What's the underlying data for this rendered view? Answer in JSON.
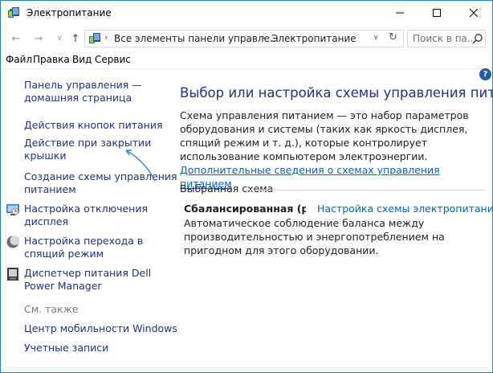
{
  "window": {
    "title": "Электропитание"
  },
  "address_bar": {
    "crumbs": [
      "Все элементы панели управле...",
      "Электропитание"
    ]
  },
  "search": {
    "placeholder": "Поиск в па..."
  },
  "menu": {
    "items": [
      "Файл",
      "Правка",
      "Вид",
      "Сервис"
    ]
  },
  "sidebar": {
    "home_link_line1": "Панель управления —",
    "home_link_line2": "домашняя страница",
    "power_buttons": "Действия кнопок питания",
    "lid_close_line1": "Действие при закрытии",
    "lid_close_line2": "крышки",
    "create_plan_line1": "Создание схемы управления",
    "create_plan_line2": "питанием",
    "display_off_line1": "Настройка отключения",
    "display_off_line2": "дисплея",
    "sleep_line1": "Настройка перехода в",
    "sleep_line2": "спящий режим",
    "dell_line1": "Диспетчер питания Dell",
    "dell_line2": "Power Manager",
    "see_also": "См. также",
    "mobility_center": "Центр мобильности Windows",
    "user_accounts": "Учетные записи"
  },
  "main": {
    "title": "Выбор или настройка схемы управления питанием",
    "description": "Схема управления питанием — это набор параметров оборудования и системы (таких как яркость дисплея, спящий режим и т. д.), которые контролирует использование компьютером электроэнергии.",
    "more_info_link": "Дополнительные сведения о схемах управления питанием",
    "section_header": "Выбранная схема",
    "plan_name": "Сбалансированная (реко",
    "plan_settings_link": "Настройка схемы электропитания",
    "plan_description": "Автоматическое соблюдение баланса между производительностью и энергопотреблением на пригодном для этого оборудовании."
  },
  "colors": {
    "link": "#1e3287",
    "inline_link": "#0066cc",
    "window_border": "#1883d7",
    "annotation_arrow": "#2e8bd8"
  },
  "icons": {
    "app": "power-options-icon",
    "close": "close-icon",
    "help": "help-icon"
  }
}
